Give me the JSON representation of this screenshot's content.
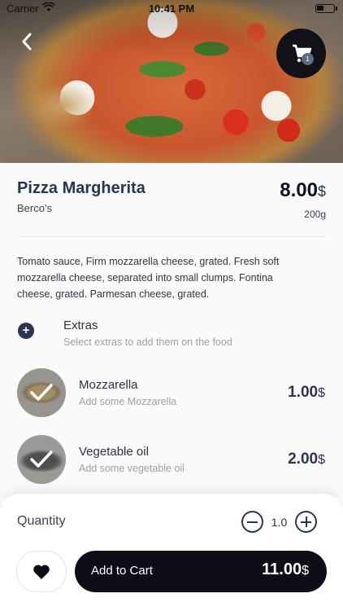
{
  "status_bar": {
    "carrier": "Carrier",
    "time": "10:41 PM"
  },
  "header": {
    "cart_count": "1"
  },
  "food": {
    "name": "Pizza Margherita",
    "restaurant": "Berco's",
    "price": "8.00",
    "currency": "$",
    "weight": "200g",
    "description": "Tomato sauce, Firm mozzarella cheese, grated. Fresh soft mozzarella cheese, separated into small clumps. Fontina cheese, grated. Parmesan cheese, grated."
  },
  "extras": {
    "title": "Extras",
    "subtitle": "Select extras to add them on the food",
    "items": [
      {
        "name": "Mozzarella",
        "description": "Add some Mozzarella",
        "price": "1.00",
        "currency": "$",
        "selected": true
      },
      {
        "name": "Vegetable oil",
        "description": "Add some vegetable oil",
        "price": "2.00",
        "currency": "$",
        "selected": true
      }
    ]
  },
  "quantity": {
    "label": "Quantity",
    "value": "1.0"
  },
  "add_to_cart": {
    "label": "Add to Cart",
    "total": "11.00",
    "currency": "$"
  },
  "colors": {
    "accent": "#2b3450",
    "button_dark": "#0c0d16",
    "muted_text": "#9aa1ac"
  },
  "icons": {
    "back": "chevron-left-icon",
    "cart": "cart-icon",
    "add": "plus-circle-icon",
    "favorite": "heart-icon",
    "check": "check-icon"
  }
}
